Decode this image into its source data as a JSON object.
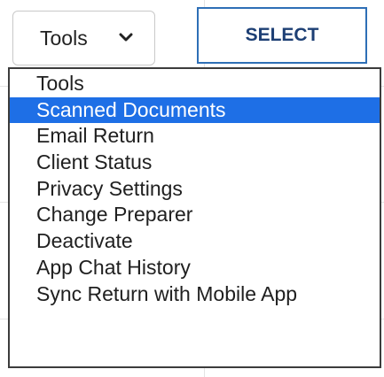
{
  "toolbar": {
    "select_value": "Tools",
    "select_button_label": "SELECT"
  },
  "dropdown": {
    "highlighted_index": 1,
    "options": [
      {
        "label": "Tools"
      },
      {
        "label": "Scanned Documents"
      },
      {
        "label": "Email Return"
      },
      {
        "label": "Client Status"
      },
      {
        "label": "Privacy Settings"
      },
      {
        "label": "Change Preparer"
      },
      {
        "label": "Deactivate"
      },
      {
        "label": "App Chat History"
      },
      {
        "label": "Sync Return with Mobile App"
      }
    ]
  },
  "icons": {
    "select_arrow": "chevron-down-icon"
  },
  "colors": {
    "highlight": "#1e6fe6",
    "button_border": "#2e6fb6",
    "button_text": "#1d3f74"
  }
}
